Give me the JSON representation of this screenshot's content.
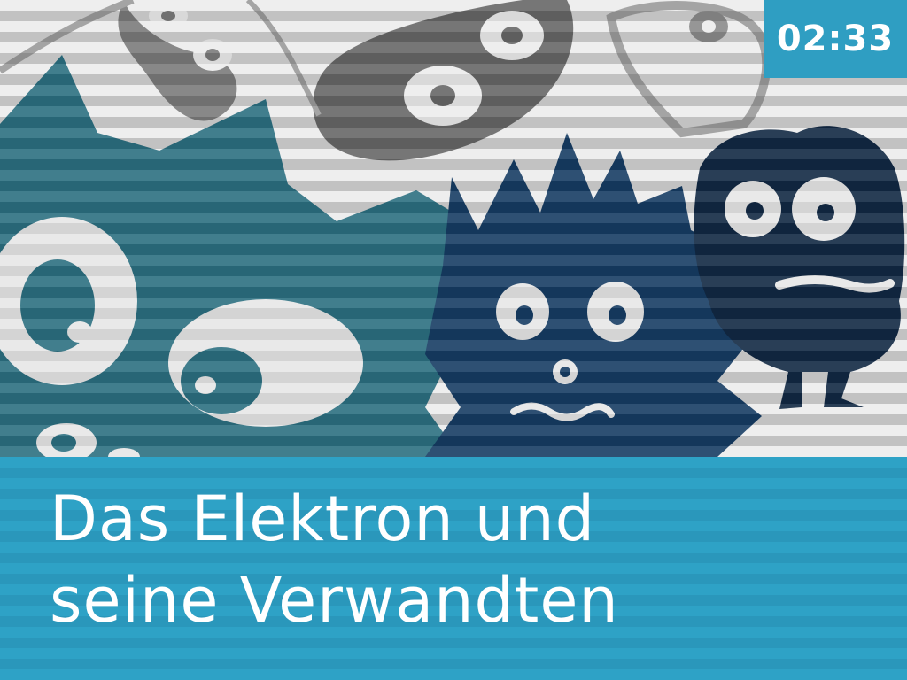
{
  "slide": {
    "timer": "02:33",
    "title_line1": "Das Elektron und",
    "title_line2": "seine Verwandten"
  },
  "colors": {
    "accent": "#2f9ec2",
    "band_light": "#2ea2c6",
    "band_dark": "#2a97bb",
    "teal_monster": "#2b6f80",
    "navy_monster": "#163c63",
    "dark_monster": "#112843",
    "gray_monster": "#646464",
    "stripe_light": "#e9e9e9",
    "stripe_dark": "#d4d4d4"
  },
  "icons": [
    "teal-monster-icon",
    "navy-monster-icon",
    "dark-monster-icon",
    "gray-monster-icon"
  ]
}
